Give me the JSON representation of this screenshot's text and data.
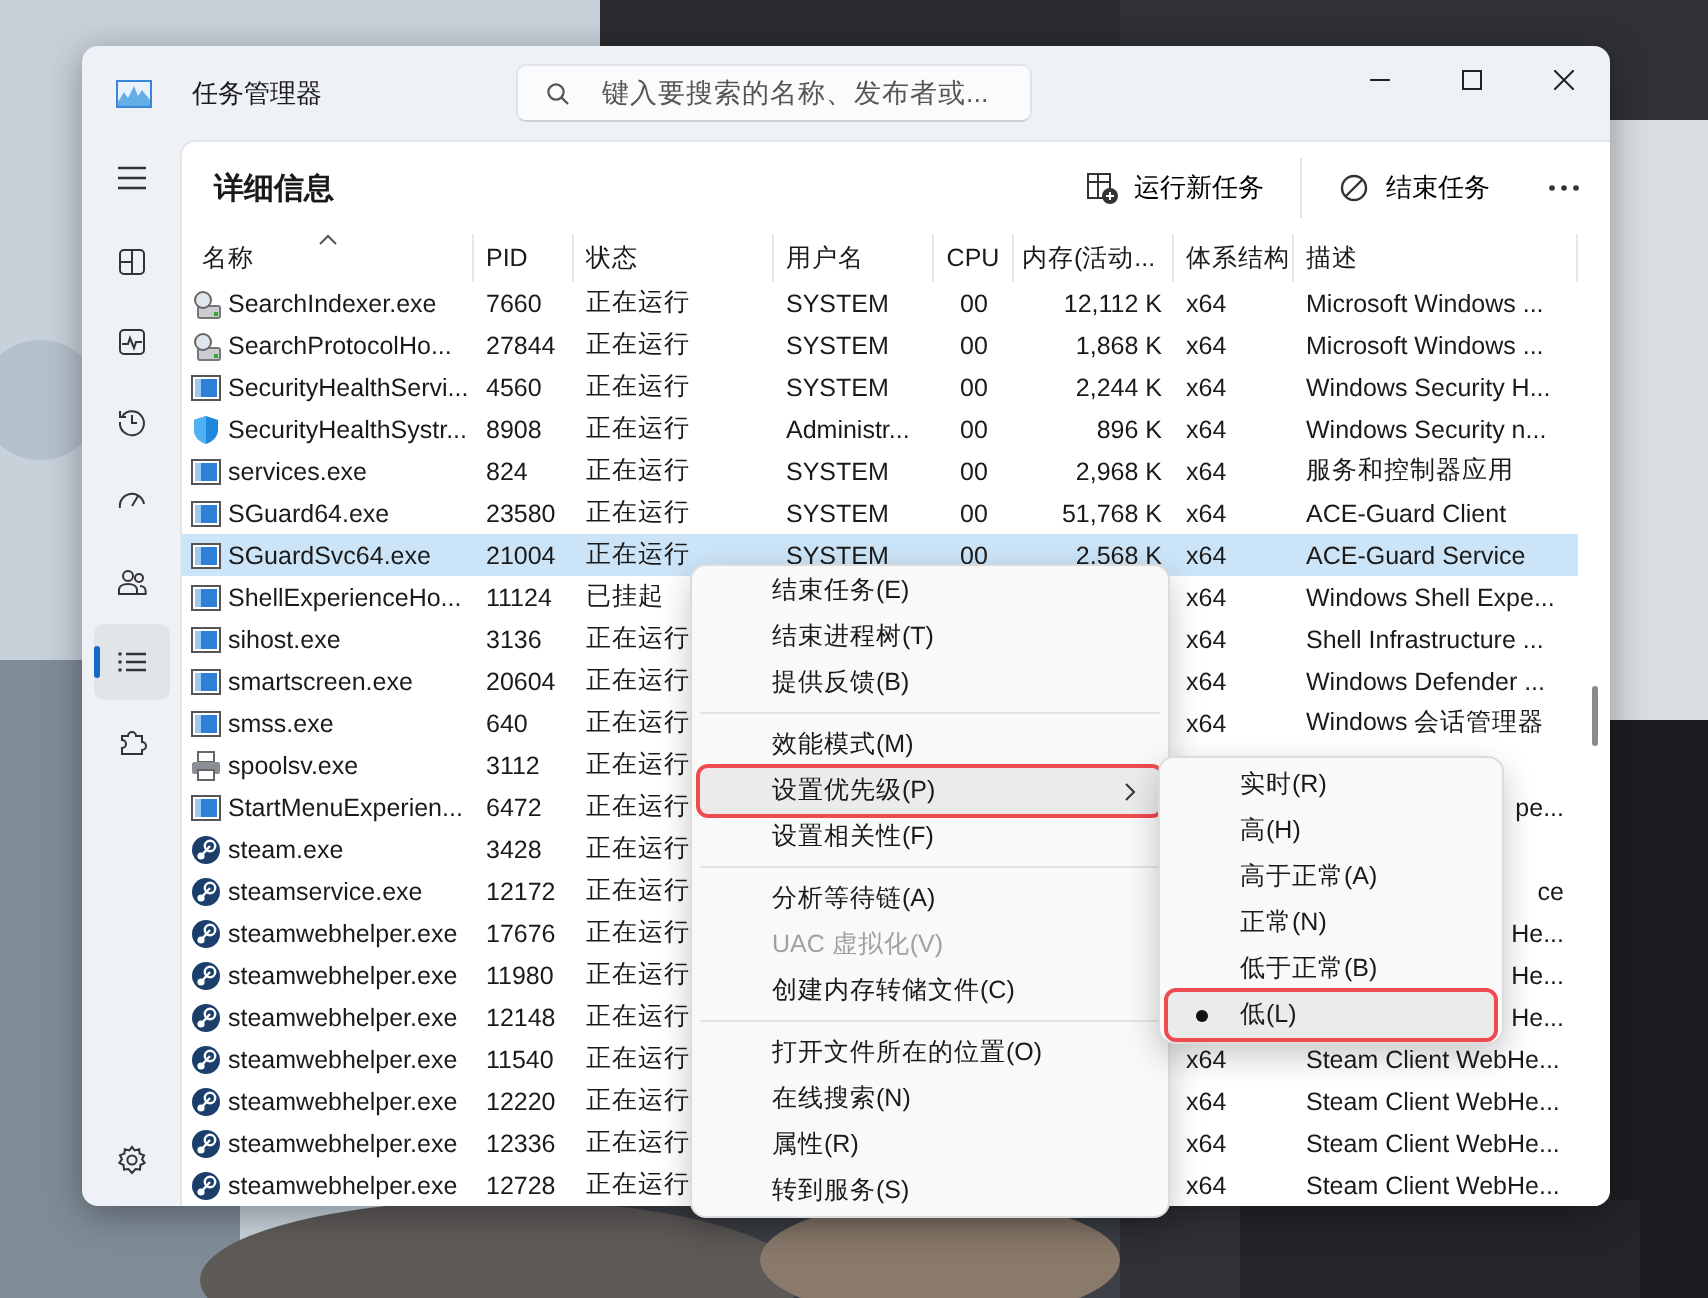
{
  "window": {
    "title": "任务管理器"
  },
  "search": {
    "placeholder": "键入要搜索的名称、发布者或..."
  },
  "nav": [
    {
      "selected": false
    },
    {
      "selected": false
    },
    {
      "selected": false
    },
    {
      "selected": false
    },
    {
      "selected": false
    },
    {
      "selected": true
    },
    {
      "selected": false
    }
  ],
  "page": {
    "title": "详细信息"
  },
  "toolbar": [
    {
      "kind": "run",
      "label": "运行新任务"
    },
    {
      "kind": "end",
      "label": "结束任务"
    }
  ],
  "table": {
    "columns": [
      {
        "label": "名称",
        "sorted": true
      },
      {
        "label": "PID",
        "sorted": false
      },
      {
        "label": "状态",
        "sorted": false
      },
      {
        "label": "用户名",
        "sorted": false
      },
      {
        "label": "CPU",
        "sorted": false
      },
      {
        "label": "内存(活动...",
        "sorted": false
      },
      {
        "label": "体系结构",
        "sorted": false
      },
      {
        "label": "描述",
        "sorted": false
      }
    ],
    "rows": [
      {
        "kind": "search",
        "name": "SearchIndexer.exe",
        "pid": "7660",
        "status": "正在运行",
        "user": "SYSTEM",
        "cpu": "00",
        "memory": "12,112 K",
        "arch": "x64",
        "description": "Microsoft Windows ...",
        "selected": false
      },
      {
        "kind": "search",
        "name": "SearchProtocolHo...",
        "pid": "27844",
        "status": "正在运行",
        "user": "SYSTEM",
        "cpu": "00",
        "memory": "1,868 K",
        "arch": "x64",
        "description": "Microsoft Windows ...",
        "selected": false
      },
      {
        "kind": "app",
        "name": "SecurityHealthServi...",
        "pid": "4560",
        "status": "正在运行",
        "user": "SYSTEM",
        "cpu": "00",
        "memory": "2,244 K",
        "arch": "x64",
        "description": "Windows Security H...",
        "selected": false
      },
      {
        "kind": "shield",
        "name": "SecurityHealthSystr...",
        "pid": "8908",
        "status": "正在运行",
        "user": "Administr...",
        "cpu": "00",
        "memory": "896 K",
        "arch": "x64",
        "description": "Windows Security n...",
        "selected": false
      },
      {
        "kind": "app",
        "name": "services.exe",
        "pid": "824",
        "status": "正在运行",
        "user": "SYSTEM",
        "cpu": "00",
        "memory": "2,968 K",
        "arch": "x64",
        "description": "服务和控制器应用",
        "selected": false
      },
      {
        "kind": "app",
        "name": "SGuard64.exe",
        "pid": "23580",
        "status": "正在运行",
        "user": "SYSTEM",
        "cpu": "00",
        "memory": "51,768 K",
        "arch": "x64",
        "description": "ACE-Guard Client",
        "selected": false
      },
      {
        "kind": "app",
        "name": "SGuardSvc64.exe",
        "pid": "21004",
        "status": "正在运行",
        "user": "SYSTEM",
        "cpu": "00",
        "memory": "2,568 K",
        "arch": "x64",
        "description": "ACE-Guard Service",
        "selected": true
      },
      {
        "kind": "app",
        "name": "ShellExperienceHo...",
        "pid": "11124",
        "status": "已挂起",
        "arch": "x64",
        "description": "Windows Shell Expe...",
        "selected": false
      },
      {
        "kind": "app",
        "name": "sihost.exe",
        "pid": "3136",
        "status": "正在运行",
        "arch": "x64",
        "description": "Shell Infrastructure ...",
        "selected": false
      },
      {
        "kind": "app",
        "name": "smartscreen.exe",
        "pid": "20604",
        "status": "正在运行",
        "arch": "x64",
        "description": "Windows Defender ...",
        "selected": false
      },
      {
        "kind": "app",
        "name": "smss.exe",
        "pid": "640",
        "status": "正在运行",
        "arch": "x64",
        "description": "Windows 会话管理器",
        "selected": false
      },
      {
        "kind": "printer",
        "name": "spoolsv.exe",
        "pid": "3112",
        "status": "正在运行",
        "selected": false
      },
      {
        "kind": "app",
        "name": "StartMenuExperien...",
        "pid": "6472",
        "status": "正在运行",
        "description_tail": "pe...",
        "selected": false
      },
      {
        "kind": "steam",
        "name": "steam.exe",
        "pid": "3428",
        "status": "正在运行",
        "selected": false
      },
      {
        "kind": "steam",
        "name": "steamservice.exe",
        "pid": "12172",
        "status": "正在运行",
        "description_tail": "ce",
        "selected": false
      },
      {
        "kind": "steam",
        "name": "steamwebhelper.exe",
        "pid": "17676",
        "status": "正在运行",
        "description_tail": "He...",
        "selected": false
      },
      {
        "kind": "steam",
        "name": "steamwebhelper.exe",
        "pid": "11980",
        "status": "正在运行",
        "description_tail": "He...",
        "selected": false
      },
      {
        "kind": "steam",
        "name": "steamwebhelper.exe",
        "pid": "12148",
        "status": "正在运行",
        "description_tail": "He...",
        "selected": false
      },
      {
        "kind": "steam",
        "name": "steamwebhelper.exe",
        "pid": "11540",
        "status": "正在运行",
        "arch": "x64",
        "description": "Steam Client WebHe...",
        "selected": false
      },
      {
        "kind": "steam",
        "name": "steamwebhelper.exe",
        "pid": "12220",
        "status": "正在运行",
        "arch": "x64",
        "description": "Steam Client WebHe...",
        "selected": false
      },
      {
        "kind": "steam",
        "name": "steamwebhelper.exe",
        "pid": "12336",
        "status": "正在运行",
        "arch": "x64",
        "description": "Steam Client WebHe...",
        "selected": false
      },
      {
        "kind": "steam",
        "name": "steamwebhelper.exe",
        "pid": "12728",
        "status": "正在运行",
        "arch": "x64",
        "description": "Steam Client WebHe...",
        "selected": false
      }
    ]
  },
  "context_menu": {
    "items": [
      {
        "kind": "item",
        "label": "结束任务(E)",
        "disabled": false,
        "highlighted": false,
        "submenu": false
      },
      {
        "kind": "item",
        "label": "结束进程树(T)",
        "disabled": false,
        "highlighted": false,
        "submenu": false
      },
      {
        "kind": "item",
        "label": "提供反馈(B)",
        "disabled": false,
        "highlighted": false,
        "submenu": false
      },
      {
        "kind": "separator"
      },
      {
        "kind": "item",
        "label": "效能模式(M)",
        "disabled": false,
        "highlighted": false,
        "submenu": false
      },
      {
        "kind": "item",
        "label": "设置优先级(P)",
        "disabled": false,
        "highlighted": true,
        "submenu": true
      },
      {
        "kind": "item",
        "label": "设置相关性(F)",
        "disabled": false,
        "highlighted": false,
        "submenu": false
      },
      {
        "kind": "separator"
      },
      {
        "kind": "item",
        "label": "分析等待链(A)",
        "disabled": false,
        "highlighted": false,
        "submenu": false
      },
      {
        "kind": "item",
        "label": "UAC 虚拟化(V)",
        "disabled": true,
        "highlighted": false,
        "submenu": false
      },
      {
        "kind": "item",
        "label": "创建内存转储文件(C)",
        "disabled": false,
        "highlighted": false,
        "submenu": false
      },
      {
        "kind": "separator"
      },
      {
        "kind": "item",
        "label": "打开文件所在的位置(O)",
        "disabled": false,
        "highlighted": false,
        "submenu": false
      },
      {
        "kind": "item",
        "label": "在线搜索(N)",
        "disabled": false,
        "highlighted": false,
        "submenu": false
      },
      {
        "kind": "item",
        "label": "属性(R)",
        "disabled": false,
        "highlighted": false,
        "submenu": false
      },
      {
        "kind": "item",
        "label": "转到服务(S)",
        "disabled": false,
        "highlighted": false,
        "submenu": false
      }
    ]
  },
  "priority_menu": {
    "items": [
      {
        "label": "实时(R)",
        "selected": false,
        "highlighted": false
      },
      {
        "label": "高(H)",
        "selected": false,
        "highlighted": false
      },
      {
        "label": "高于正常(A)",
        "selected": false,
        "highlighted": false
      },
      {
        "label": "正常(N)",
        "selected": false,
        "highlighted": false
      },
      {
        "label": "低于正常(B)",
        "selected": false,
        "highlighted": false
      },
      {
        "label": "低(L)",
        "selected": true,
        "highlighted": true
      }
    ]
  }
}
